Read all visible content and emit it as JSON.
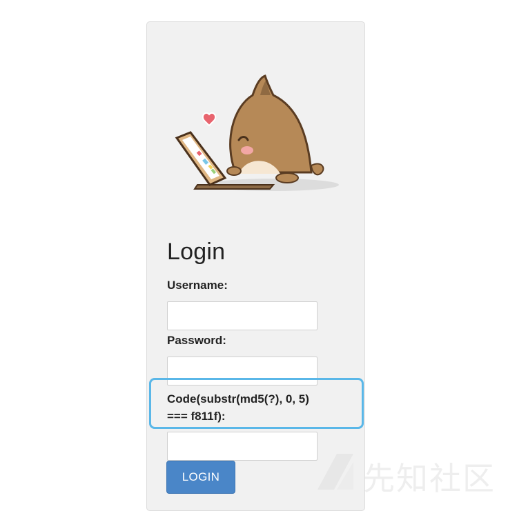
{
  "login": {
    "title": "Login",
    "username_label": "Username:",
    "username_value": "",
    "password_label": "Password:",
    "password_value": "",
    "code_label": "Code(substr(md5(?), 0, 5)\n=== f811f):",
    "code_value": "",
    "submit_label": "LOGIN"
  },
  "watermark": {
    "text": "先知社区"
  },
  "colors": {
    "panel_bg": "#f1f1f1",
    "button_bg": "#4a86c8",
    "highlight_border": "#5ab7e8"
  },
  "icons": {
    "mascot": "cat-mascot-with-laptop",
    "watermark_logo": "watermark-logo-icon"
  }
}
